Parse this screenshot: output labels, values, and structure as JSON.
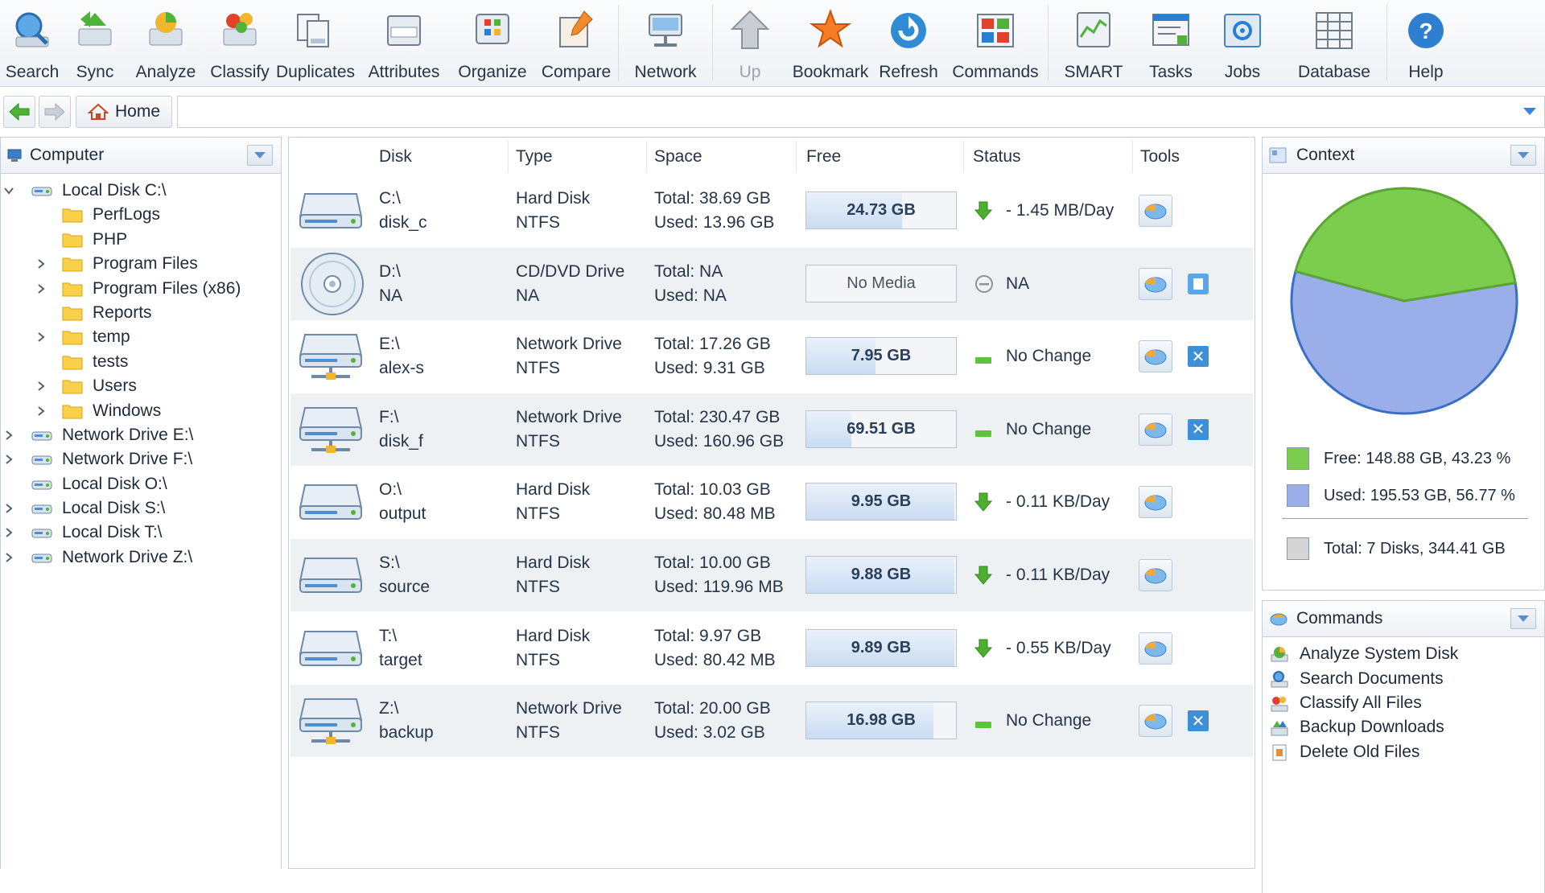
{
  "toolbar": {
    "buttons": [
      {
        "label": "Search",
        "icon": "search-icon"
      },
      {
        "label": "Sync",
        "icon": "sync-icon"
      },
      {
        "label": "Analyze",
        "icon": "analyze-icon"
      },
      {
        "label": "Classify",
        "icon": "classify-icon"
      },
      {
        "label": "Duplicates",
        "icon": "duplicates-icon"
      },
      {
        "label": "Attributes",
        "icon": "attributes-icon"
      },
      {
        "label": "Organize",
        "icon": "organize-icon"
      },
      {
        "label": "Compare",
        "icon": "compare-icon"
      },
      {
        "label": "Network",
        "icon": "network-icon"
      },
      {
        "label": "Up",
        "icon": "up-arrow-icon"
      },
      {
        "label": "Bookmark",
        "icon": "star-icon"
      },
      {
        "label": "Refresh",
        "icon": "refresh-icon"
      },
      {
        "label": "Commands",
        "icon": "commands-icon"
      },
      {
        "label": "SMART",
        "icon": "smart-icon"
      },
      {
        "label": "Tasks",
        "icon": "tasks-icon"
      },
      {
        "label": "Jobs",
        "icon": "jobs-icon"
      },
      {
        "label": "Database",
        "icon": "database-icon"
      },
      {
        "label": "Help",
        "icon": "help-icon"
      }
    ]
  },
  "address": {
    "home_label": "Home",
    "path": ""
  },
  "left_panel": {
    "title": "Computer",
    "tree": [
      {
        "label": "Local Disk C:\\",
        "type": "drive",
        "level": 0,
        "expander": "expanded"
      },
      {
        "label": "PerfLogs",
        "type": "folder",
        "level": 1,
        "expander": "none"
      },
      {
        "label": "PHP",
        "type": "folder",
        "level": 1,
        "expander": "none"
      },
      {
        "label": "Program Files",
        "type": "folder",
        "level": 1,
        "expander": "collapsed"
      },
      {
        "label": "Program Files (x86)",
        "type": "folder",
        "level": 1,
        "expander": "collapsed"
      },
      {
        "label": "Reports",
        "type": "folder",
        "level": 1,
        "expander": "none"
      },
      {
        "label": "temp",
        "type": "folder",
        "level": 1,
        "expander": "collapsed"
      },
      {
        "label": "tests",
        "type": "folder",
        "level": 1,
        "expander": "none"
      },
      {
        "label": "Users",
        "type": "folder",
        "level": 1,
        "expander": "collapsed"
      },
      {
        "label": "Windows",
        "type": "folder",
        "level": 1,
        "expander": "collapsed"
      },
      {
        "label": "Network Drive E:\\",
        "type": "drive",
        "level": 0,
        "expander": "collapsed"
      },
      {
        "label": "Network Drive F:\\",
        "type": "drive",
        "level": 0,
        "expander": "collapsed"
      },
      {
        "label": "Local Disk O:\\",
        "type": "drive",
        "level": 0,
        "expander": "none"
      },
      {
        "label": "Local Disk S:\\",
        "type": "drive",
        "level": 0,
        "expander": "collapsed"
      },
      {
        "label": "Local Disk T:\\",
        "type": "drive",
        "level": 0,
        "expander": "collapsed"
      },
      {
        "label": "Network Drive Z:\\",
        "type": "drive",
        "level": 0,
        "expander": "collapsed"
      }
    ]
  },
  "disk_table": {
    "columns": [
      "Disk",
      "Type",
      "Space",
      "Free",
      "Status",
      "Tools"
    ],
    "rows": [
      {
        "drive": "C:\\",
        "name": "disk_c",
        "icon": "hard-disk-icon",
        "type": "Hard Disk",
        "fs": "NTFS",
        "total": "Total: 38.69 GB",
        "used": "Used: 13.96 GB",
        "free": "24.73 GB",
        "free_fraction": 0.64,
        "status_icon": "down-arrow-icon",
        "status": "- 1.45 MB/Day",
        "extra_tool": "none"
      },
      {
        "drive": "D:\\",
        "name": "NA",
        "icon": "cd-dvd-icon",
        "type": "CD/DVD Drive",
        "fs": "NA",
        "total": "Total: NA",
        "used": "Used: NA",
        "free": "No Media",
        "free_fraction": 0,
        "status_icon": "na-icon",
        "status": "NA",
        "extra_tool": "document"
      },
      {
        "drive": "E:\\",
        "name": "alex-s",
        "icon": "network-drive-icon",
        "type": "Network Drive",
        "fs": "NTFS",
        "total": "Total: 17.26 GB",
        "used": "Used: 9.31 GB",
        "free": "7.95 GB",
        "free_fraction": 0.46,
        "status_icon": "no-change-icon",
        "status": "No Change",
        "extra_tool": "close"
      },
      {
        "drive": "F:\\",
        "name": "disk_f",
        "icon": "network-drive-icon",
        "type": "Network Drive",
        "fs": "NTFS",
        "total": "Total: 230.47 GB",
        "used": "Used: 160.96 GB",
        "free": "69.51 GB",
        "free_fraction": 0.3,
        "status_icon": "no-change-icon",
        "status": "No Change",
        "extra_tool": "close"
      },
      {
        "drive": "O:\\",
        "name": "output",
        "icon": "hard-disk-icon",
        "type": "Hard Disk",
        "fs": "NTFS",
        "total": "Total: 10.03 GB",
        "used": "Used: 80.48 MB",
        "free": "9.95 GB",
        "free_fraction": 0.99,
        "status_icon": "down-arrow-icon",
        "status": "- 0.11 KB/Day",
        "extra_tool": "none"
      },
      {
        "drive": "S:\\",
        "name": "source",
        "icon": "hard-disk-icon",
        "type": "Hard Disk",
        "fs": "NTFS",
        "total": "Total: 10.00 GB",
        "used": "Used: 119.96 MB",
        "free": "9.88 GB",
        "free_fraction": 0.99,
        "status_icon": "down-arrow-icon",
        "status": "- 0.11 KB/Day",
        "extra_tool": "none"
      },
      {
        "drive": "T:\\",
        "name": "target",
        "icon": "hard-disk-icon",
        "type": "Hard Disk",
        "fs": "NTFS",
        "total": "Total: 9.97 GB",
        "used": "Used: 80.42 MB",
        "free": "9.89 GB",
        "free_fraction": 0.99,
        "status_icon": "down-arrow-icon",
        "status": "- 0.55 KB/Day",
        "extra_tool": "none"
      },
      {
        "drive": "Z:\\",
        "name": "backup",
        "icon": "network-drive-icon",
        "type": "Network Drive",
        "fs": "NTFS",
        "total": "Total: 20.00 GB",
        "used": "Used: 3.02 GB",
        "free": "16.98 GB",
        "free_fraction": 0.85,
        "status_icon": "no-change-icon",
        "status": "No Change",
        "extra_tool": "close"
      }
    ]
  },
  "context_panel": {
    "title": "Context",
    "pie": {
      "free_fraction": 0.4323,
      "used_fraction": 0.5677
    },
    "legend": [
      {
        "label": "Free: 148.88 GB, 43.23 %",
        "color": "#7ccd4e"
      },
      {
        "label": "Used: 195.53 GB, 56.77 %",
        "color": "#9aaeea"
      },
      {
        "label": "Total: 7 Disks, 344.41 GB",
        "color": "#d5d5d5"
      }
    ]
  },
  "commands_panel": {
    "title": "Commands",
    "items": [
      {
        "label": "Analyze System Disk",
        "icon": "analyze-icon"
      },
      {
        "label": "Search Documents",
        "icon": "search-icon"
      },
      {
        "label": "Classify All Files",
        "icon": "classify-icon"
      },
      {
        "label": "Backup Downloads",
        "icon": "backup-icon"
      },
      {
        "label": "Delete Old Files",
        "icon": "delete-icon"
      }
    ]
  },
  "colors": {
    "accent": "#3d8fd8",
    "free_green": "#7ccd4e",
    "used_blue": "#9aaeea",
    "status_down": "#4caf2f",
    "status_nochange": "#5cc33a"
  }
}
